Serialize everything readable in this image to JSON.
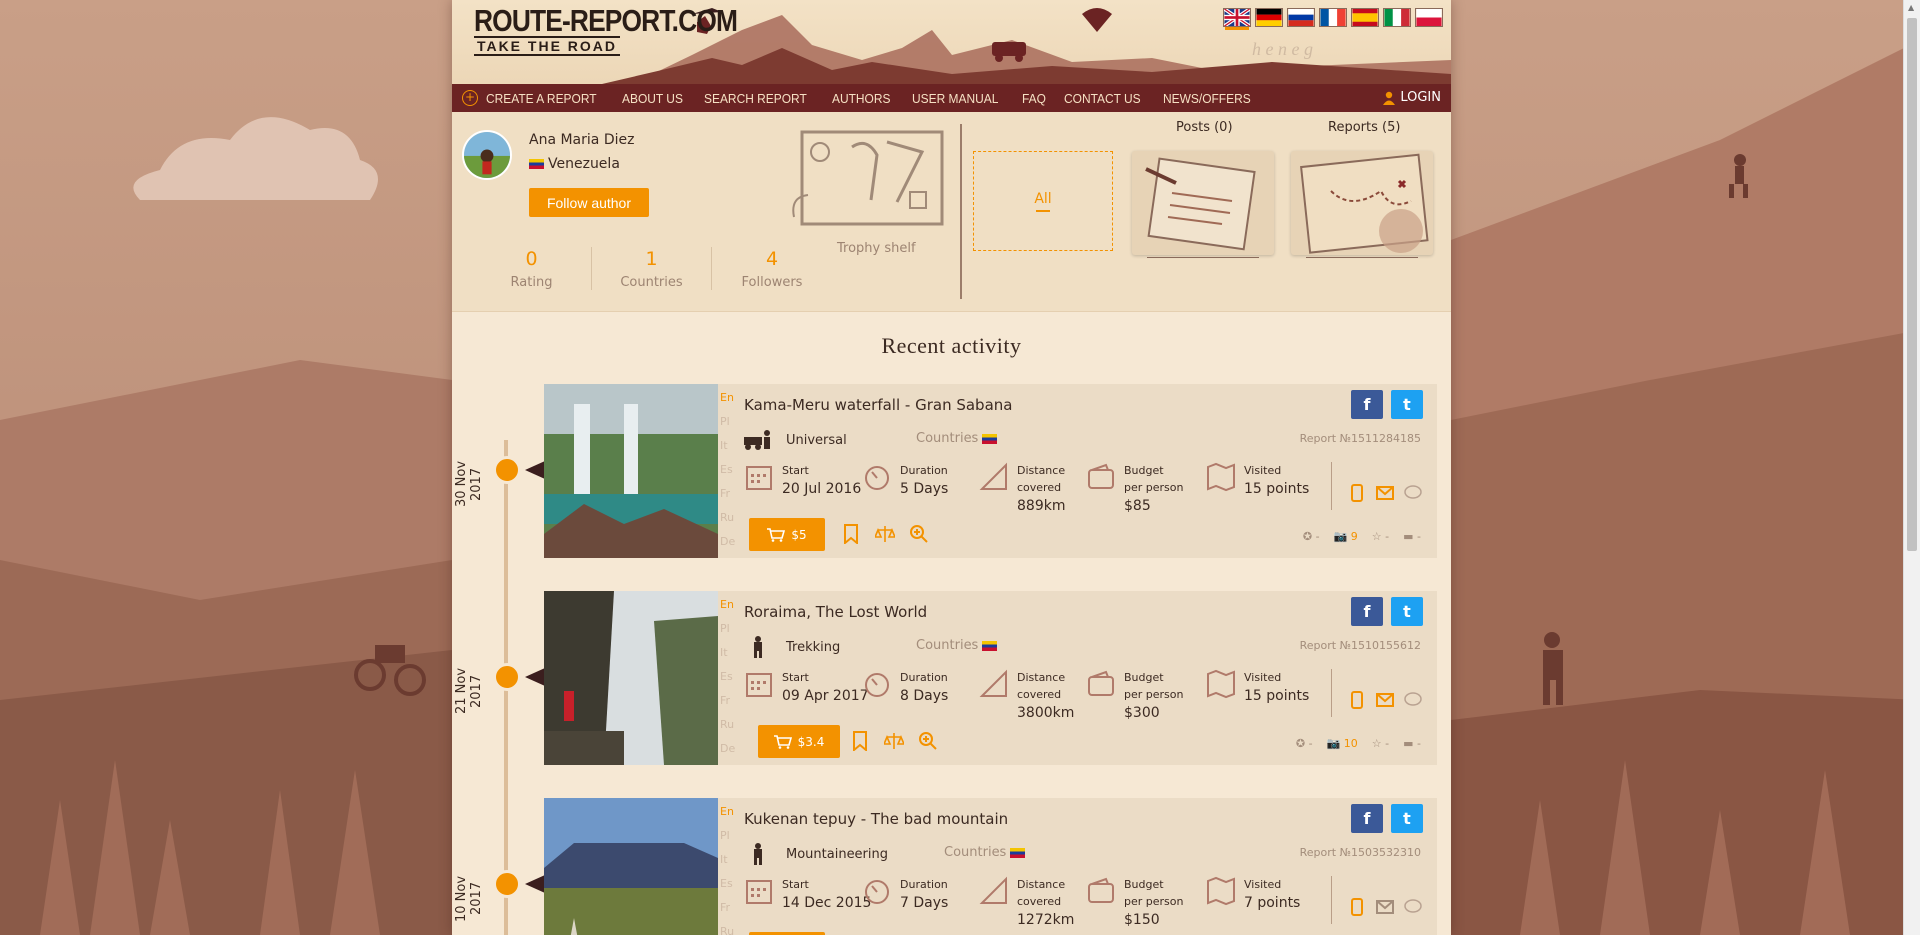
{
  "brand": {
    "logo_line1": "ROUTE-REPORT.COM",
    "logo_line2": "TAKE THE ROAD",
    "accent": "#f39200",
    "nav_bg": "#6b2323"
  },
  "languages": [
    "English",
    "German",
    "Russian",
    "French",
    "Spanish",
    "Italian",
    "Polish"
  ],
  "nav": {
    "items": [
      "CREATE A REPORT",
      "ABOUT US",
      "SEARCH REPORT",
      "AUTHORS",
      "USER MANUAL",
      "FAQ",
      "CONTACT US",
      "NEWS/OFFERS"
    ],
    "login": "LOGIN"
  },
  "profile": {
    "name": "Ana Maria Diez",
    "country": "Venezuela",
    "follow_label": "Follow author",
    "stats": [
      {
        "value": "0",
        "label": "Rating"
      },
      {
        "value": "1",
        "label": "Countries"
      },
      {
        "value": "4",
        "label": "Followers"
      }
    ],
    "trophy_label": "Trophy shelf",
    "tabs": {
      "all": "All",
      "posts": "Posts (0)",
      "reports": "Reports (5)"
    }
  },
  "activity": {
    "title": "Recent activity",
    "lang_tabs": [
      "En",
      "Pl",
      "It",
      "Es",
      "Fr",
      "Ru",
      "De"
    ],
    "labels": {
      "countries": "Countries",
      "start": "Start",
      "duration": "Duration",
      "distance": "Distance covered",
      "budget": "Budget per person",
      "visited": "Visited"
    },
    "items": [
      {
        "date": "30 Nov 2017",
        "title": "Kama-Meru waterfall - Gran Sabana",
        "type": "Universal",
        "report_no": "Report №1511284185",
        "start": "20 Jul 2016",
        "duration": "5 Days",
        "distance": "889km",
        "budget": "$85",
        "visited": "15 points",
        "price": "$5",
        "photos": "9",
        "rating": "-",
        "stars": "-",
        "comments": "-"
      },
      {
        "date": "21 Nov 2017",
        "title": "Roraima, The Lost World",
        "type": "Trekking",
        "report_no": "Report №1510155612",
        "start": "09 Apr 2017",
        "duration": "8 Days",
        "distance": "3800km",
        "budget": "$300",
        "visited": "15 points",
        "price": "$3.4",
        "photos": "10",
        "rating": "-",
        "stars": "-",
        "comments": "-"
      },
      {
        "date": "10 Nov 2017",
        "title": "Kukenan tepuy - The bad mountain",
        "type": "Mountaineering",
        "report_no": "Report №1503532310",
        "start": "14 Dec 2015",
        "duration": "7 Days",
        "distance": "1272km",
        "budget": "$150",
        "visited": "7 points",
        "price": "",
        "photos": "",
        "rating": "",
        "stars": "",
        "comments": ""
      }
    ]
  }
}
